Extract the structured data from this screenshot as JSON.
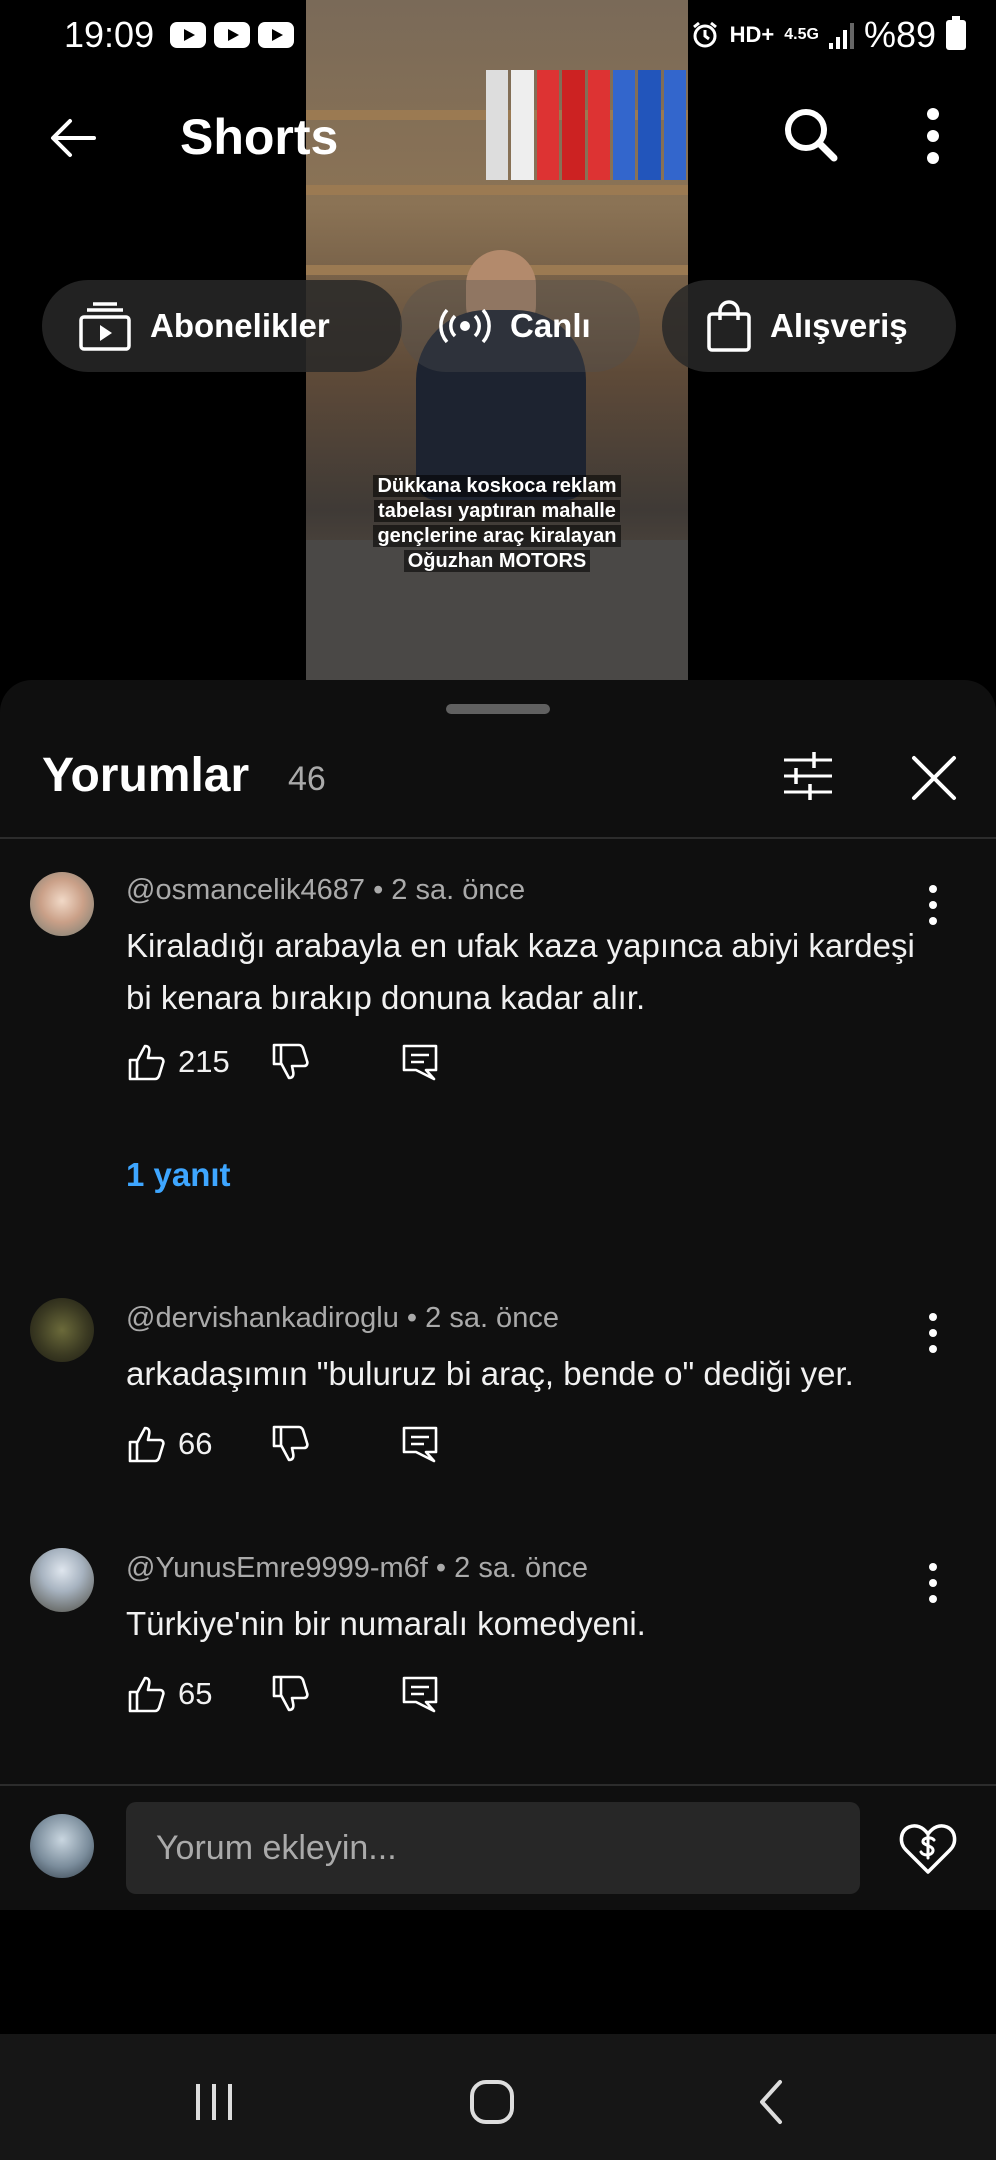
{
  "status_bar": {
    "time": "19:09",
    "network": "HD+",
    "network_gen": "4.5G",
    "battery": "%89"
  },
  "video": {
    "caption_lines": [
      "Dükkana koskoca reklam",
      "tabelası yaptıran mahalle",
      "gençlerine araç kiralayan",
      "Oğuzhan MOTORS"
    ]
  },
  "top_bar": {
    "title": "Shorts"
  },
  "chips": [
    {
      "label": "Abonelikler",
      "icon": "subscriptions-icon"
    },
    {
      "label": "Canlı",
      "icon": "live-icon"
    },
    {
      "label": "Alışveriş",
      "icon": "shopping-bag-icon"
    }
  ],
  "comments_panel": {
    "title": "Yorumlar",
    "count": "46",
    "add_comment_placeholder": "Yorum ekleyin...",
    "comments": [
      {
        "author": "@osmancelik4687",
        "time": "2 sa. önce",
        "meta": "@osmancelik4687 • 2 sa. önce",
        "text": "Kiraladığı arabayla en ufak kaza yapınca abiyi kardeşi bi kenara bırakıp donuna kadar alır.",
        "likes": "215",
        "replies": "1 yanıt"
      },
      {
        "author": "@dervishankadiroglu",
        "time": "2 sa. önce",
        "meta": "@dervishankadiroglu • 2 sa. önce",
        "text": "arkadaşımın \"buluruz bi araç, bende o\" dediği yer.",
        "likes": "66"
      },
      {
        "author": "@YunusEmre9999-m6f",
        "time": "2 sa. önce",
        "meta": "@YunusEmre9999-m6f • 2 sa. önce",
        "text": "Türkiye'nin bir numaralı komedyeni.",
        "likes": "65"
      }
    ]
  },
  "colors": {
    "background": "#000000",
    "sheet": "#0f0f0f",
    "link": "#3ea6ff",
    "secondary_text": "#aaaaaa",
    "input_bg": "#272727"
  }
}
